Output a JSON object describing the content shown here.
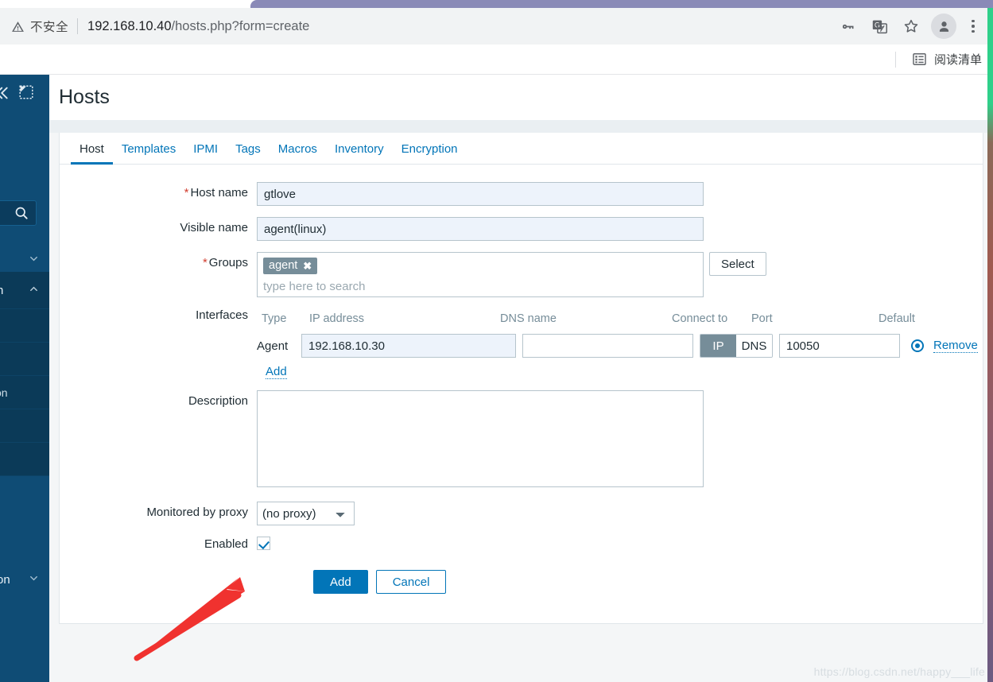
{
  "browser": {
    "security_label": "不安全",
    "url_host": "192.168.10.40",
    "url_path": "/hosts.php?form=create",
    "icons": {
      "warning": "warning-triangle-icon",
      "key": "key-icon",
      "translate": "translate-icon",
      "bookmark": "star-icon",
      "profile": "profile-avatar-icon",
      "menu": "three-dot-menu-icon"
    },
    "bookmarks": {
      "reading_list": "阅读清单",
      "reading_list_icon": "reading-list-icon"
    }
  },
  "sidebar": {
    "collapse_icon": "collapse-sidebar-icon",
    "expand_icon": "expand-view-icon",
    "search_icon": "search-icon",
    "entries": [
      {
        "fragment": "",
        "chevron": "chevron-down-icon"
      },
      {
        "fragment": "",
        "chevron": "chevron-down-icon"
      },
      {
        "fragment": "",
        "chevron": "chevron-down-icon"
      },
      {
        "fragment": "n",
        "chevron": "chevron-up-icon"
      }
    ],
    "sub_entries": [
      {
        "fragment": ""
      },
      {
        "fragment": ""
      },
      {
        "fragment": "on"
      },
      {
        "fragment": ""
      },
      {
        "fragment": ""
      }
    ],
    "bottom_entry": {
      "fragment": "on",
      "chevron": "chevron-down-icon"
    }
  },
  "page": {
    "title": "Hosts",
    "watermark": "https://blog.csdn.net/happy___life"
  },
  "tabs": [
    {
      "label": "Host",
      "active": true
    },
    {
      "label": "Templates",
      "active": false
    },
    {
      "label": "IPMI",
      "active": false
    },
    {
      "label": "Tags",
      "active": false
    },
    {
      "label": "Macros",
      "active": false
    },
    {
      "label": "Inventory",
      "active": false
    },
    {
      "label": "Encryption",
      "active": false
    }
  ],
  "form": {
    "host_name": {
      "label": "Host name",
      "required": true,
      "value": "gtlove"
    },
    "visible_name": {
      "label": "Visible name",
      "required": false,
      "value": "agent(linux)"
    },
    "groups": {
      "label": "Groups",
      "required": true,
      "chips": [
        {
          "text": "agent",
          "remove_icon": "close-icon"
        }
      ],
      "placeholder": "type here to search",
      "select_button": "Select"
    },
    "interfaces": {
      "label": "Interfaces",
      "columns": [
        "Type",
        "IP address",
        "DNS name",
        "Connect to",
        "Port",
        "Default"
      ],
      "rows": [
        {
          "type": "Agent",
          "ip_address": "192.168.10.30",
          "dns_name": "",
          "connect_to_options": [
            "IP",
            "DNS"
          ],
          "connect_to_selected": "IP",
          "port": "10050",
          "default_selected": true,
          "remove_label": "Remove"
        }
      ],
      "add_link": "Add"
    },
    "description": {
      "label": "Description",
      "value": ""
    },
    "monitored_by_proxy": {
      "label": "Monitored by proxy",
      "value": "(no proxy)",
      "options": [
        "(no proxy)"
      ]
    },
    "enabled": {
      "label": "Enabled",
      "checked": true
    },
    "buttons": {
      "submit": "Add",
      "cancel": "Cancel"
    }
  },
  "annotation": {
    "arrow_color": "#f0322f",
    "points_to": "add-button"
  },
  "colors": {
    "accent": "#0275b8",
    "sidebar": "#0f4c75",
    "required": "#d23f31",
    "chip": "#768d99",
    "input_filled": "#edf3fb"
  }
}
